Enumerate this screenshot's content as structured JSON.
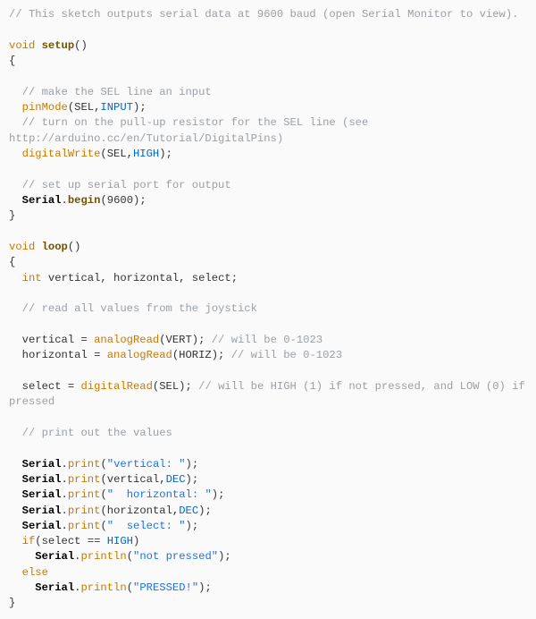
{
  "c1": "// This sketch outputs serial data at 9600 baud (open Serial Monitor to view).",
  "kw_void1": "void",
  "fn_setup": "setup",
  "setup_parens": "()",
  "obrace1": "{",
  "c2": "// make the SEL line an input",
  "fn_pinMode1": "pinMode",
  "pm1_open": "(SEL,",
  "const_INPUT": "INPUT",
  "pm1_close": ");",
  "c3a": "// turn on the pull-up resistor for the SEL line (see ",
  "c3b": "http://arduino.cc/en/Tutorial/DigitalPins)",
  "fn_digitalWrite1": "digitalWrite",
  "dw1_open": "(SEL,",
  "const_HIGH1": "HIGH",
  "dw1_close": ");",
  "c4": "// set up serial port for output",
  "obj_Serial1": "Serial",
  "dot1": ".",
  "fn_begin": "begin",
  "begin_args": "(9600);",
  "cbrace1": "}",
  "kw_void2": "void",
  "fn_loop": "loop",
  "loop_parens": "()",
  "obrace2": "{",
  "type_int": "int",
  "decls": " vertical, horizontal, select;",
  "c5": "// read all values from the joystick",
  "var_v": "vertical = ",
  "fn_aR1": "analogRead",
  "aR1_args": "(VERT); ",
  "c6": "// will be 0-1023",
  "var_h": "horizontal = ",
  "fn_aR2": "analogRead",
  "aR2_args": "(HORIZ); ",
  "c7": "// will be 0-1023",
  "var_s": "select = ",
  "fn_dR": "digitalRead",
  "dR_args": "(SEL); ",
  "c8": "// will be HIGH (1) if not pressed, and LOW (0) if pressed",
  "c9": "// print out the values",
  "S2": "Serial",
  "d2": ".",
  "p2": "print",
  "s2open": "(",
  "str2": "\"vertical: \"",
  "s2close": ");",
  "S3": "Serial",
  "d3": ".",
  "p3": "print",
  "s3open": "(vertical,",
  "const_DEC1": "DEC",
  "s3close": ");",
  "S4": "Serial",
  "d4": ".",
  "p4": "print",
  "s4open": "(",
  "str4": "\"  horizontal: \"",
  "s4close": ");",
  "S5": "Serial",
  "d5": ".",
  "p5": "print",
  "s5open": "(horizontal,",
  "const_DEC2": "DEC",
  "s5close": ");",
  "S6": "Serial",
  "d6": ".",
  "p6": "print",
  "s6open": "(",
  "str6": "\"  select: \"",
  "s6close": ");",
  "kw_if": "if",
  "if_open": "(select == ",
  "const_HIGH2": "HIGH",
  "if_close": ")",
  "S7": "Serial",
  "d7": ".",
  "p7": "println",
  "s7open": "(",
  "str7": "\"not pressed\"",
  "s7close": ");",
  "kw_else": "else",
  "S8": "Serial",
  "d8": ".",
  "p8": "println",
  "s8open": "(",
  "str8": "\"PRESSED!\"",
  "s8close": ");",
  "cbrace2": "}"
}
